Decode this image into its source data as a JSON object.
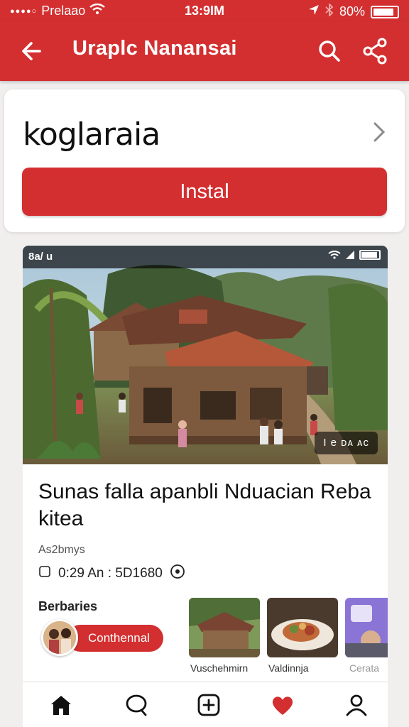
{
  "status_bar": {
    "carrier": "Prelaao",
    "time": "13:9IM",
    "battery": "80%"
  },
  "app_bar": {
    "title": "Uraplc Nanansai"
  },
  "install_card": {
    "app_name": "koglaraia",
    "install_label": "Instal"
  },
  "post": {
    "photo_status_time": "8a/ u",
    "photo_tag": "I  e ᴅᴀ ᴀᴄ",
    "headline": "Sunas falla apanbli Nduacian Reba kitea",
    "byline": "As2bmys",
    "meta": "0:29 An : 5D1680"
  },
  "related": {
    "section_label": "Berbaries",
    "follow_label": "Conthennal",
    "thumbnails": [
      {
        "label": "Vuschehmirn"
      },
      {
        "label": "Valdinnja"
      },
      {
        "label": "Cerata"
      }
    ]
  },
  "bottom_nav": {
    "items": [
      "home",
      "chat",
      "add",
      "favorites",
      "profile"
    ]
  },
  "colors": {
    "accent": "#d32f30",
    "background": "#f1eeee"
  }
}
